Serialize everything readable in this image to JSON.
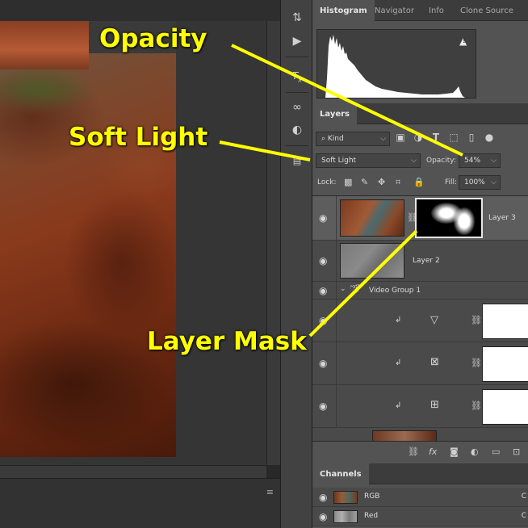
{
  "annotations": {
    "opacity": "Opacity",
    "blend": "Soft Light",
    "mask": "Layer Mask",
    "color": "#ffff00"
  },
  "tools": [
    "history-icon",
    "play-icon",
    "character-style-icon",
    "creative-cloud-icon",
    "adjustment-icon",
    "properties-icon"
  ],
  "histogram_panel": {
    "tabs": [
      "Histogram",
      "Navigator",
      "Info",
      "Clone Source"
    ],
    "active_tab": "Histogram",
    "warning_icon": "warning-triangle-icon"
  },
  "layers_panel": {
    "tab": "Layers",
    "filter_label": "Kind",
    "blend_mode": "Soft Light",
    "opacity_label": "Opacity:",
    "opacity_value": "54%",
    "lock_label": "Lock:",
    "fill_label": "Fill:",
    "fill_value": "100%",
    "layers": [
      {
        "name": "Layer 3",
        "selected": true
      },
      {
        "name": "Layer 2",
        "selected": false
      },
      {
        "name": "Video Group 1",
        "selected": false
      },
      {
        "name": "",
        "adjustment": "levels-icon"
      },
      {
        "name": "",
        "adjustment": "gradient-map-icon"
      },
      {
        "name": "",
        "adjustment": "curves-icon"
      }
    ]
  },
  "channels_panel": {
    "tab": "Channels",
    "channels": [
      {
        "name": "RGB",
        "shortcut": "C"
      },
      {
        "name": "Red",
        "shortcut": "C"
      }
    ]
  }
}
